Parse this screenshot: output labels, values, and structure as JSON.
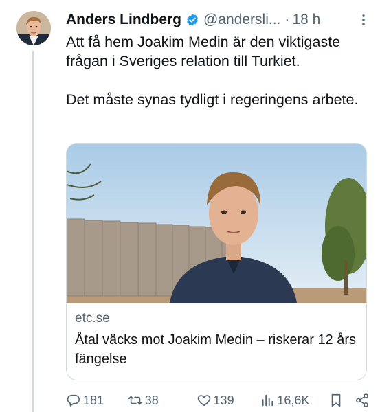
{
  "author": {
    "name": "Anders Lindberg",
    "handle": "@andersli...",
    "separator": "·",
    "time": "18 h",
    "avatar_icon": "avatar-photo",
    "verified_icon": "verified-badge-icon",
    "verified_color": "#1d9bf0"
  },
  "tweet": {
    "paragraphs": [
      "Att få hem Joakim Medin är den viktigaste frågan i Sveriges relation till Turkiet.",
      "Det måste synas tydligt i regeringens arbete."
    ]
  },
  "card": {
    "image_icon": "article-photo",
    "domain": "etc.se",
    "title": "Åtal väcks mot Joakim Medin – riskerar 12 års fängelse"
  },
  "actions": {
    "replies": "181",
    "retweets": "38",
    "likes": "139",
    "views": "16,6K"
  },
  "colors": {
    "text": "#0f1419",
    "muted": "#536471",
    "border": "#cfd9de",
    "accent": "#1d9bf0"
  }
}
